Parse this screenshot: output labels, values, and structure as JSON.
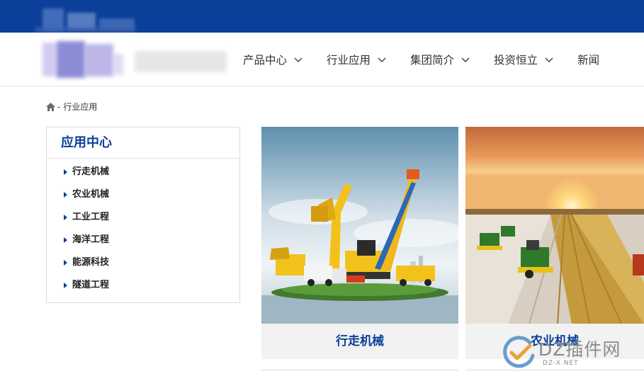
{
  "nav": {
    "items": [
      {
        "label": "产品中心"
      },
      {
        "label": "行业应用"
      },
      {
        "label": "集团简介"
      },
      {
        "label": "投资恒立"
      },
      {
        "label": "新闻"
      }
    ]
  },
  "breadcrumb": {
    "separator": "-",
    "current": "行业应用"
  },
  "sidebar": {
    "title": "应用中心",
    "items": [
      {
        "label": "行走机械"
      },
      {
        "label": "农业机械"
      },
      {
        "label": "工业工程"
      },
      {
        "label": "海洋工程"
      },
      {
        "label": "能源科技"
      },
      {
        "label": "隧道工程"
      }
    ]
  },
  "cards": [
    {
      "label": "行走机械",
      "image_icon": "construction-machinery-photo"
    },
    {
      "label": "农业机械",
      "image_icon": "agricultural-harvest-photo"
    }
  ],
  "watermark": {
    "text": "DZ插件网",
    "sub": "DZ-X.NET"
  },
  "colors": {
    "brand_blue": "#0b3f9a",
    "card_bg": "#f2f2f2",
    "border": "#dcdcdc"
  }
}
